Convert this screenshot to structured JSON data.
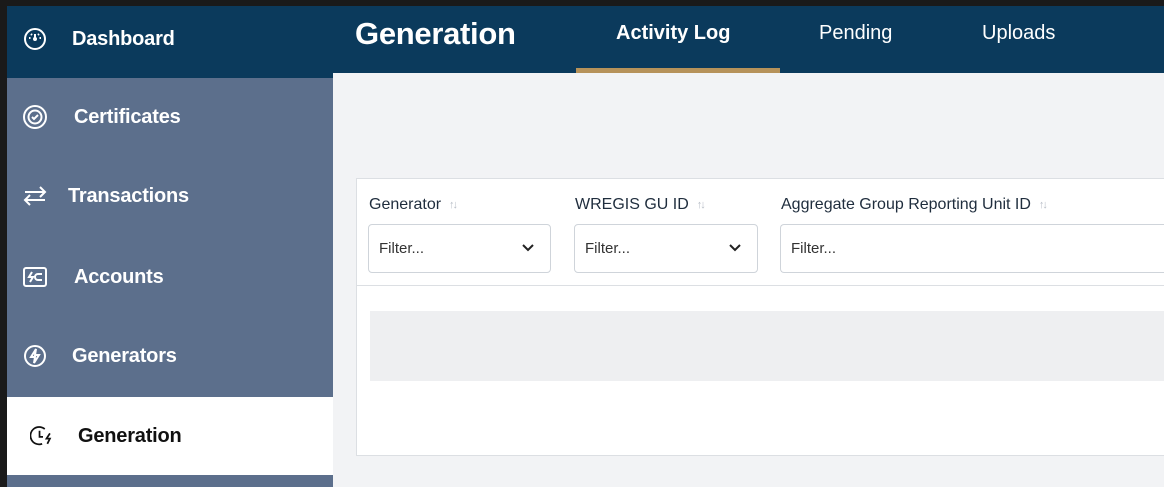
{
  "sidebar": {
    "items": [
      {
        "label": "Dashboard",
        "icon": "dashboard-icon"
      },
      {
        "label": "Certificates",
        "icon": "certificate-icon"
      },
      {
        "label": "Transactions",
        "icon": "transactions-icon"
      },
      {
        "label": "Accounts",
        "icon": "accounts-icon"
      },
      {
        "label": "Generators",
        "icon": "lightning-icon"
      },
      {
        "label": "Generation",
        "icon": "generation-clock-icon"
      }
    ],
    "active": "Generation"
  },
  "header": {
    "title": "Generation",
    "tabs": [
      {
        "label": "Activity Log",
        "active": true
      },
      {
        "label": "Pending",
        "active": false
      },
      {
        "label": "Uploads",
        "active": false
      }
    ]
  },
  "table": {
    "columns": [
      {
        "label": "Generator",
        "filter_placeholder": "Filter...",
        "dropdown": true
      },
      {
        "label": "WREGIS GU ID",
        "filter_placeholder": "Filter...",
        "dropdown": true
      },
      {
        "label": "Aggregate Group Reporting Unit ID",
        "filter_placeholder": "Filter...",
        "dropdown": false
      }
    ]
  },
  "colors": {
    "navy": "#0b3a5c",
    "sidebar": "#5c6f8c",
    "accent": "#b6925a"
  }
}
